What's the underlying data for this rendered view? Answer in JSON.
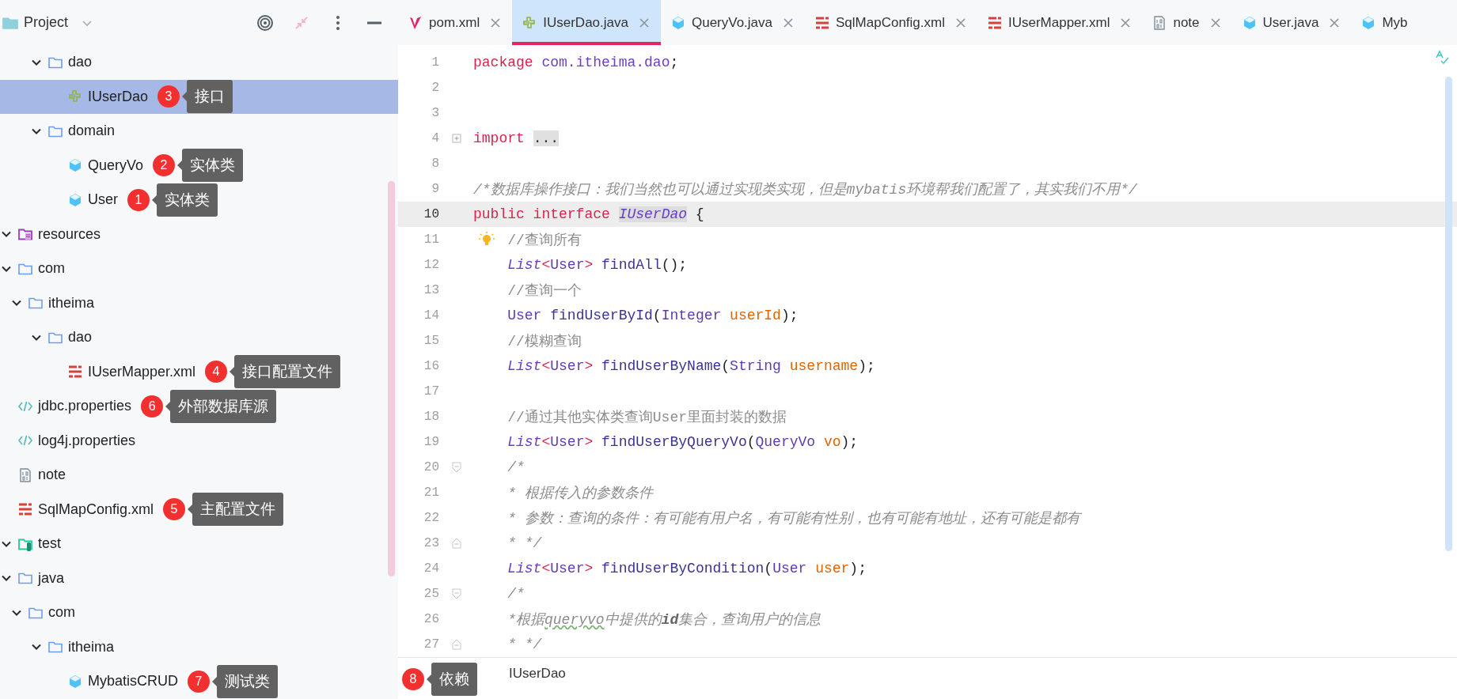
{
  "project_panel": {
    "title": "Project"
  },
  "tabs": [
    {
      "label": "pom.xml",
      "kind": "maven",
      "selected": false,
      "closable": true
    },
    {
      "label": "IUserDao.java",
      "kind": "interface",
      "selected": true,
      "closable": true
    },
    {
      "label": "QueryVo.java",
      "kind": "class",
      "selected": false,
      "closable": true
    },
    {
      "label": "SqlMapConfig.xml",
      "kind": "xml",
      "selected": false,
      "closable": true
    },
    {
      "label": "IUserMapper.xml",
      "kind": "xml",
      "selected": false,
      "closable": true
    },
    {
      "label": "note",
      "kind": "text",
      "selected": false,
      "closable": true
    },
    {
      "label": "User.java",
      "kind": "class",
      "selected": false,
      "closable": true
    },
    {
      "label": "Myb",
      "kind": "class",
      "selected": false,
      "closable": false
    }
  ],
  "tree": [
    {
      "children": [
        {
          "children": [
            {
              "children": [
                {
                  "label": "dao",
                  "kind": "folder",
                  "expanded": true,
                  "selected": false,
                  "children": [
                    {
                      "label": "IUserDao",
                      "kind": "interface",
                      "selected": true,
                      "note": {
                        "number": "3",
                        "text": "接口"
                      }
                    }
                  ]
                },
                {
                  "label": "domain",
                  "kind": "folder",
                  "expanded": true,
                  "selected": false,
                  "children": [
                    {
                      "label": "QueryVo",
                      "kind": "class",
                      "selected": false,
                      "note": {
                        "number": "2",
                        "text": "实体类"
                      }
                    },
                    {
                      "label": "User",
                      "kind": "class",
                      "selected": false,
                      "note": {
                        "number": "1",
                        "text": "实体类"
                      }
                    }
                  ]
                }
              ]
            }
          ]
        }
      ]
    },
    {
      "label": "resources",
      "kind": "resources",
      "expanded": true,
      "selected": false,
      "children": [
        {
          "label": "com",
          "kind": "folder",
          "expanded": true,
          "selected": false,
          "children": [
            {
              "label": "itheima",
              "kind": "folder",
              "expanded": true,
              "selected": false,
              "children": [
                {
                  "label": "dao",
                  "kind": "folder",
                  "expanded": true,
                  "selected": false,
                  "children": [
                    {
                      "label": "IUserMapper.xml",
                      "kind": "xml",
                      "selected": false,
                      "note": {
                        "number": "4",
                        "text": "接口配置文件"
                      }
                    }
                  ]
                }
              ]
            }
          ]
        },
        {
          "label": "jdbc.properties",
          "kind": "properties",
          "selected": false,
          "note": {
            "number": "6",
            "text": "外部数据库源"
          }
        },
        {
          "label": "log4j.properties",
          "kind": "properties",
          "selected": false
        },
        {
          "label": "note",
          "kind": "text",
          "selected": false
        },
        {
          "label": "SqlMapConfig.xml",
          "kind": "xml",
          "selected": false,
          "note": {
            "number": "5",
            "text": "主配置文件"
          }
        }
      ]
    },
    {
      "label": "test",
      "kind": "test",
      "expanded": true,
      "selected": false,
      "children": [
        {
          "label": "java",
          "kind": "folder",
          "expanded": true,
          "selected": false,
          "children": [
            {
              "label": "com",
              "kind": "folder",
              "expanded": true,
              "selected": false,
              "children": [
                {
                  "label": "itheima",
                  "kind": "folder",
                  "expanded": true,
                  "selected": false,
                  "children": [
                    {
                      "label": "MybatisCRUD",
                      "kind": "class",
                      "selected": false,
                      "note": {
                        "number": "7",
                        "text": "测试类"
                      }
                    }
                  ]
                }
              ]
            }
          ]
        }
      ]
    }
  ],
  "floating_note": {
    "number": "8",
    "text": "依赖"
  },
  "editor": {
    "lines": [
      {
        "number": "1",
        "current": false,
        "tokens": [
          {
            "kind": "kw",
            "text": "package"
          },
          {
            "kind": "pkg",
            "text": " com.itheima.dao"
          },
          {
            "kind": "plain",
            "text": ";"
          }
        ]
      },
      {
        "number": "2",
        "current": false
      },
      {
        "number": "3",
        "current": false
      },
      {
        "number": "4",
        "current": false,
        "fold": {
          "kind": "collapsed"
        },
        "tokens": [
          {
            "kind": "kw",
            "text": "import "
          },
          {
            "kind": "folded",
            "text": "..."
          }
        ]
      },
      {
        "number": "8",
        "current": false
      },
      {
        "number": "9",
        "current": false,
        "tokens": [
          {
            "kind": "block_comment",
            "text": "/*数据库操作接口：我们当然也可以通过实现类实现，但是mybatis环境帮我们配置了，其实我们不用*/"
          }
        ]
      },
      {
        "number": "10",
        "current": true,
        "tokens": [
          {
            "kind": "kw",
            "text": "public interface "
          },
          {
            "kind": "decl",
            "text": "IUserDao"
          },
          {
            "kind": "plain",
            "text": " {"
          }
        ]
      },
      {
        "number": "11",
        "current": false,
        "bulb": true,
        "tokens": [
          {
            "kind": "line_comment",
            "text": "//查询所有"
          }
        ]
      },
      {
        "number": "12",
        "current": false,
        "tokens": [
          {
            "kind": "generic",
            "text": "    List"
          },
          {
            "kind": "angle",
            "text": "<"
          },
          {
            "kind": "type",
            "text": "User"
          },
          {
            "kind": "angle",
            "text": ">"
          },
          {
            "kind": "fn",
            "text": " findAll"
          },
          {
            "kind": "plain",
            "text": "();"
          }
        ]
      },
      {
        "number": "13",
        "current": false,
        "tokens": [
          {
            "kind": "line_comment",
            "text": "    //查询一个"
          }
        ]
      },
      {
        "number": "14",
        "current": false,
        "tokens": [
          {
            "kind": "type",
            "text": "    User"
          },
          {
            "kind": "fn",
            "text": " findUserById"
          },
          {
            "kind": "plain",
            "text": "("
          },
          {
            "kind": "type",
            "text": "Integer"
          },
          {
            "kind": "param",
            "text": " userId"
          },
          {
            "kind": "plain",
            "text": ");"
          }
        ]
      },
      {
        "number": "15",
        "current": false,
        "tokens": [
          {
            "kind": "line_comment",
            "text": "    //模糊查询"
          }
        ]
      },
      {
        "number": "16",
        "current": false,
        "tokens": [
          {
            "kind": "generic",
            "text": "    List"
          },
          {
            "kind": "angle",
            "text": "<"
          },
          {
            "kind": "type",
            "text": "User"
          },
          {
            "kind": "angle",
            "text": ">"
          },
          {
            "kind": "fn",
            "text": " findUserByName"
          },
          {
            "kind": "plain",
            "text": "("
          },
          {
            "kind": "type",
            "text": "String"
          },
          {
            "kind": "param",
            "text": " username"
          },
          {
            "kind": "plain",
            "text": ");"
          }
        ]
      },
      {
        "number": "17",
        "current": false
      },
      {
        "number": "18",
        "current": false,
        "tokens": [
          {
            "kind": "line_comment",
            "text": "    //通过其他实体类查询User里面封装的数据"
          }
        ]
      },
      {
        "number": "19",
        "current": false,
        "tokens": [
          {
            "kind": "generic",
            "text": "    List"
          },
          {
            "kind": "angle",
            "text": "<"
          },
          {
            "kind": "type",
            "text": "User"
          },
          {
            "kind": "angle",
            "text": ">"
          },
          {
            "kind": "fn",
            "text": " findUserByQueryVo"
          },
          {
            "kind": "plain",
            "text": "("
          },
          {
            "kind": "type",
            "text": "QueryVo"
          },
          {
            "kind": "param",
            "text": " vo"
          },
          {
            "kind": "plain",
            "text": ");"
          }
        ]
      },
      {
        "number": "20",
        "current": false,
        "fold": {
          "kind": "start"
        },
        "tokens": [
          {
            "kind": "block_comment",
            "text": "    /*"
          }
        ]
      },
      {
        "number": "21",
        "current": false,
        "tokens": [
          {
            "kind": "block_comment",
            "text": "    * 根据传入的参数条件"
          }
        ]
      },
      {
        "number": "22",
        "current": false,
        "tokens": [
          {
            "kind": "block_comment",
            "text": "    * 参数：查询的条件：有可能有用户名，有可能有性别，也有可能有地址，还有可能是都有"
          }
        ]
      },
      {
        "number": "23",
        "current": false,
        "fold": {
          "kind": "end"
        },
        "tokens": [
          {
            "kind": "block_comment",
            "text": "    * */"
          }
        ]
      },
      {
        "number": "24",
        "current": false,
        "tokens": [
          {
            "kind": "generic",
            "text": "    List"
          },
          {
            "kind": "angle",
            "text": "<"
          },
          {
            "kind": "type",
            "text": "User"
          },
          {
            "kind": "angle",
            "text": ">"
          },
          {
            "kind": "fn",
            "text": " findUserByCondition"
          },
          {
            "kind": "plain",
            "text": "("
          },
          {
            "kind": "type",
            "text": "User"
          },
          {
            "kind": "param",
            "text": " user"
          },
          {
            "kind": "plain",
            "text": ");"
          }
        ]
      },
      {
        "number": "25",
        "current": false,
        "fold": {
          "kind": "start"
        },
        "tokens": [
          {
            "kind": "block_comment",
            "text": "    /*"
          }
        ]
      },
      {
        "number": "26",
        "current": false,
        "tokens": [
          {
            "kind": "block_comment",
            "text": "    *根据"
          },
          {
            "kind": "typo_comment",
            "text": "queryvo"
          },
          {
            "kind": "marked_comment",
            "text": "中提供的**id**集合，查询用户的信息"
          }
        ]
      },
      {
        "number": "27",
        "current": false,
        "fold": {
          "kind": "end"
        },
        "tokens": [
          {
            "kind": "block_comment",
            "text": "    * */"
          }
        ]
      }
    ],
    "breadcrumb": "IUserDao"
  }
}
